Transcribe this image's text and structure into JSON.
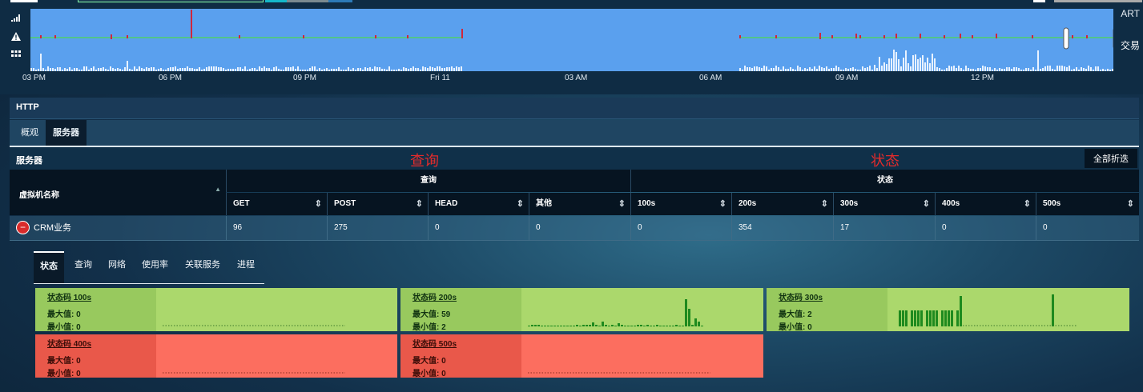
{
  "timeline": {
    "right_labels": {
      "art": "ART",
      "trade": "交易"
    },
    "time_labels": [
      "03 PM",
      "06 PM",
      "09 PM",
      "Fri 11",
      "03 AM",
      "06 AM",
      "09 AM",
      "12 PM"
    ],
    "icons": [
      "signal-bars-icon",
      "warning-icon",
      "grid-icon"
    ]
  },
  "http": {
    "title": "HTTP"
  },
  "tabs": [
    {
      "label": "概观",
      "active": false
    },
    {
      "label": "服务器",
      "active": true
    }
  ],
  "server_section": {
    "title": "服务器",
    "query_overlay": "查询",
    "status_overlay": "状态",
    "collapse_all_label": "全部折迭"
  },
  "table": {
    "vm_header": "虚拟机名称",
    "group_query": "查询",
    "group_status": "状态",
    "columns": [
      "GET",
      "POST",
      "HEAD",
      "其他",
      "100s",
      "200s",
      "300s",
      "400s",
      "500s"
    ],
    "rows": [
      {
        "name": "CRM业务",
        "values": [
          "96",
          "275",
          "0",
          "0",
          "0",
          "354",
          "17",
          "0",
          "0"
        ]
      }
    ]
  },
  "detail_tabs": [
    {
      "label": "状态",
      "active": true
    },
    {
      "label": "查询",
      "active": false
    },
    {
      "label": "网络",
      "active": false
    },
    {
      "label": "使用率",
      "active": false
    },
    {
      "label": "关联服务",
      "active": false
    },
    {
      "label": "进程",
      "active": false
    }
  ],
  "status_cards": [
    {
      "title": "状态码 100s",
      "max": "最大值: 0",
      "min": "最小值: 0",
      "tone": "green"
    },
    {
      "title": "状态码 200s",
      "max": "最大值: 59",
      "min": "最小值: 2",
      "tone": "green"
    },
    {
      "title": "状态码 300s",
      "max": "最大值: 2",
      "min": "最小值: 0",
      "tone": "green"
    },
    {
      "title": "状态码 400s",
      "max": "最大值: 0",
      "min": "最小值: 0",
      "tone": "red"
    },
    {
      "title": "状态码 500s",
      "max": "最大值: 0",
      "min": "最小值: 0",
      "tone": "red"
    }
  ],
  "colors": {
    "green_card": "#abd86c",
    "red_card": "#fc6e5f",
    "overlay_red": "#e32b2b",
    "chart_blue": "#5aa0ee"
  }
}
